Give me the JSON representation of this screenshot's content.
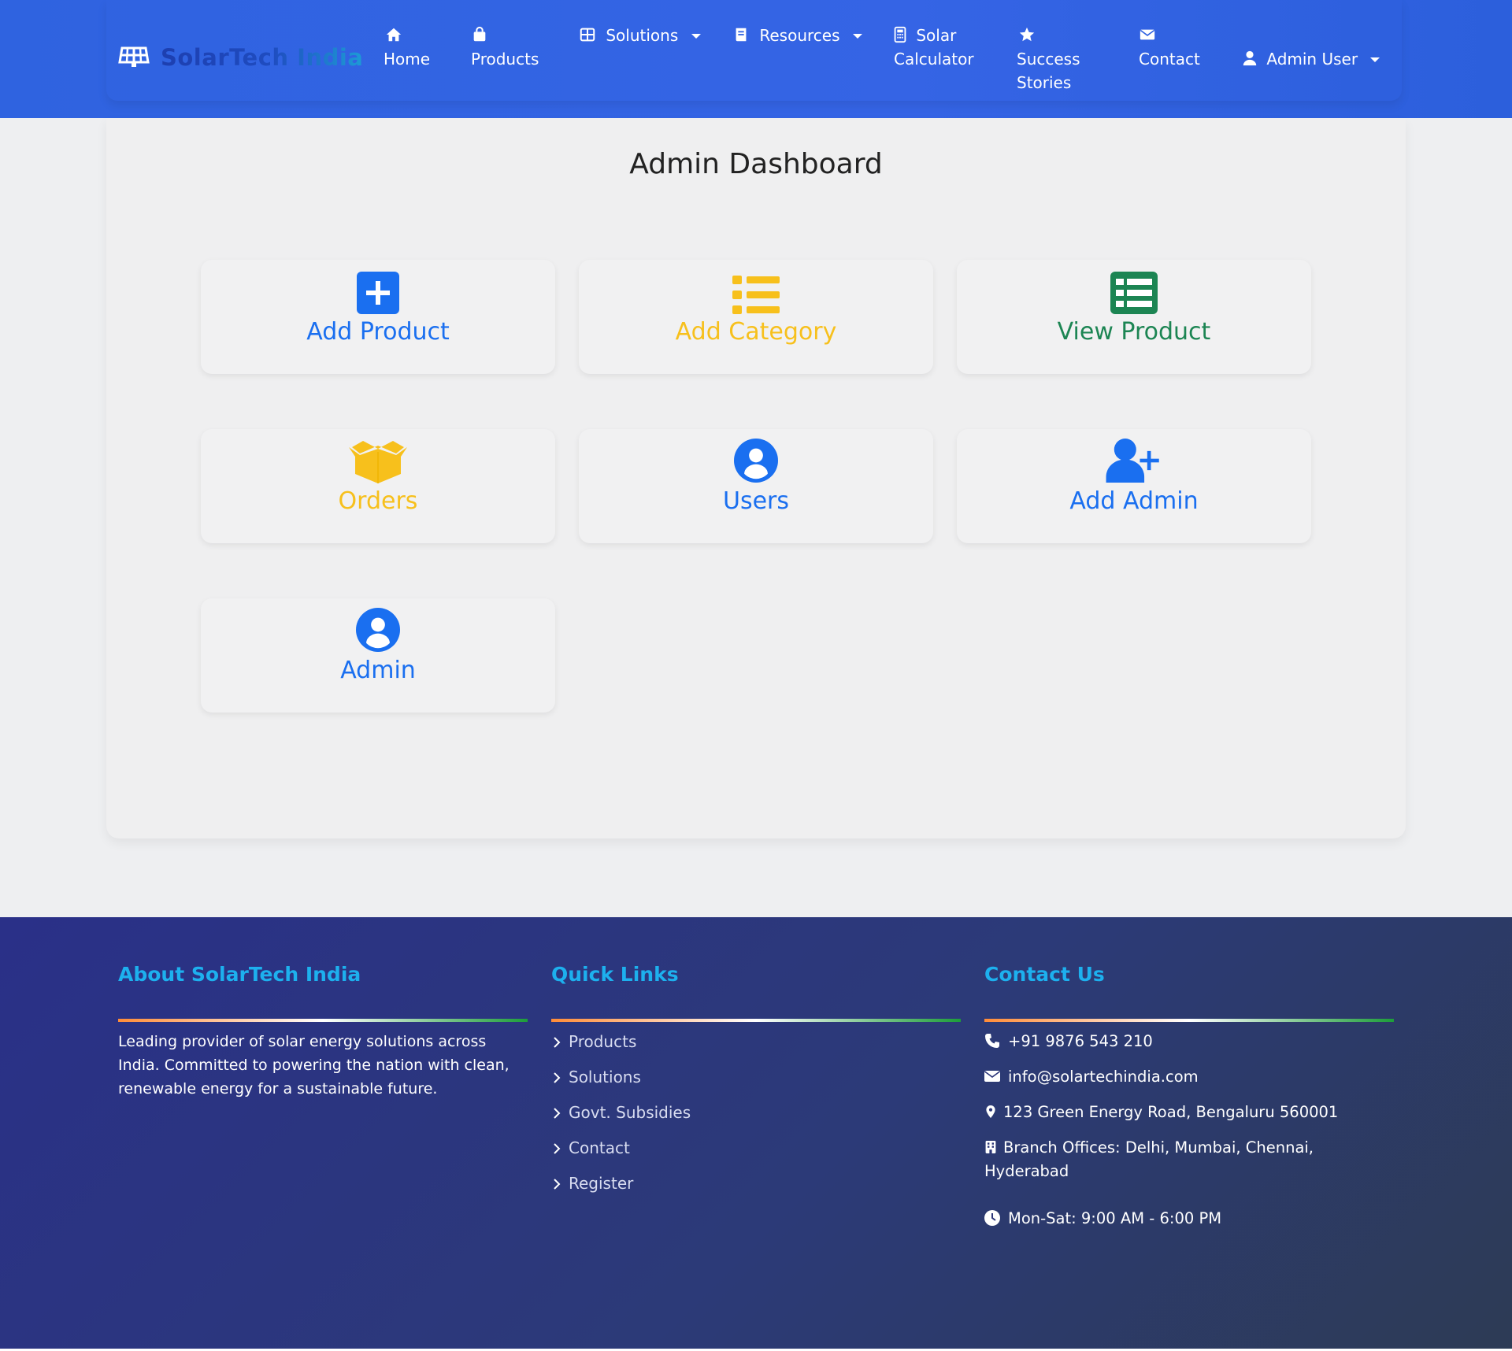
{
  "navbar": {
    "brand": "SolarTech India",
    "items": [
      {
        "label": "Home",
        "icon": "home-icon"
      },
      {
        "label": "Products",
        "icon": "shopping-bag-icon"
      },
      {
        "label": "Solutions",
        "icon": "grid-icon",
        "dropdown": true
      },
      {
        "label": "Resources",
        "icon": "book-icon",
        "dropdown": true
      },
      {
        "label_line1": "Solar",
        "label_line2": "Calculator",
        "icon": "calculator-icon"
      },
      {
        "label_line1": "Success",
        "label_line2": "Stories",
        "icon": "star-icon"
      },
      {
        "label": "Contact",
        "icon": "envelope-icon"
      },
      {
        "label": "Admin User",
        "icon": "user-icon",
        "dropdown": true
      }
    ]
  },
  "dashboard": {
    "title": "Admin Dashboard",
    "tiles": [
      {
        "label": "Add Product",
        "icon": "plus-square-icon",
        "color": "#1a6ff0"
      },
      {
        "label": "Add Category",
        "icon": "list-icon",
        "color": "#f7c01c"
      },
      {
        "label": "View Product",
        "icon": "table-icon",
        "color": "#1c8553"
      },
      {
        "label": "Orders",
        "icon": "box-open-icon",
        "color": "#f7c01c"
      },
      {
        "label": "Users",
        "icon": "user-circle-icon",
        "color": "#1a6ff0"
      },
      {
        "label": "Add Admin",
        "icon": "user-plus-icon",
        "color": "#1a6ff0"
      },
      {
        "label": "Admin",
        "icon": "user-circle-icon",
        "color": "#1a6ff0"
      }
    ]
  },
  "footer": {
    "about": {
      "heading": "About SolarTech India",
      "text": "Leading provider of solar energy solutions across India. Committed to powering the nation with clean, renewable energy for a sustainable future."
    },
    "quick_links": {
      "heading": "Quick Links",
      "links": [
        "Products",
        "Solutions",
        "Govt. Subsidies",
        "Contact",
        "Register"
      ]
    },
    "contact": {
      "heading": "Contact Us",
      "phone": "+91 9876 543 210",
      "email": "info@solartechindia.com",
      "address": "123 Green Energy Road, Bengaluru 560001",
      "branch_line1": "Branch Offices: Delhi, Mumbai, Chennai,",
      "branch_line2": "Hyderabad",
      "hours": "Mon-Sat: 9:00 AM - 6:00 PM"
    }
  },
  "colors": {
    "nav_bg": "#3063e2",
    "accent_blue": "#1a6ff0",
    "accent_yellow": "#f7c01c",
    "accent_green": "#1c8553",
    "footer_heading": "#1db0ee"
  }
}
